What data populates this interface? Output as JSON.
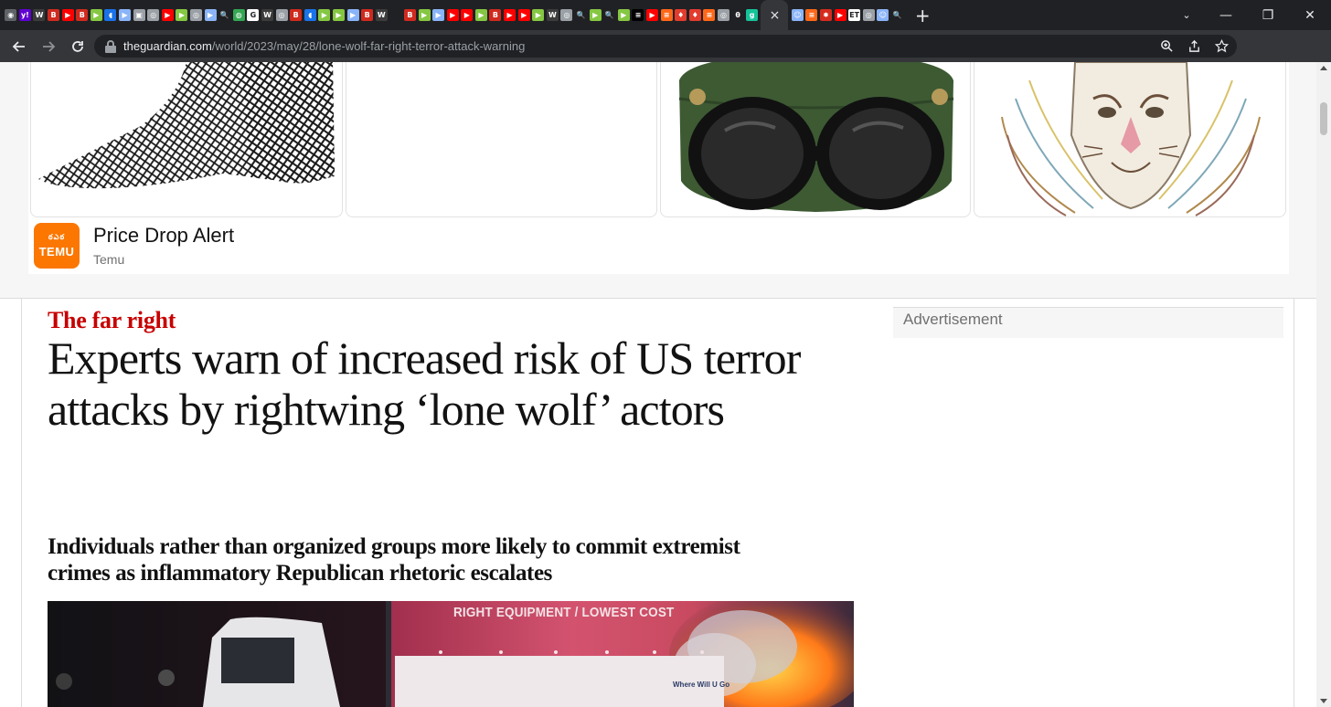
{
  "browser": {
    "url_host": "theguardian.com",
    "url_path": "/world/2023/may/28/lone-wolf-far-right-terror-attack-warning",
    "tab_favicons": [
      {
        "icon": "chrome-icon",
        "color": "#5f6368",
        "glyph": "◉"
      },
      {
        "icon": "yahoo-icon",
        "color": "#6001d2",
        "glyph": "y!"
      },
      {
        "icon": "wsj-icon",
        "color": "#3c3c3c",
        "glyph": "W"
      },
      {
        "icon": "business-insider-icon",
        "color": "#d02a1e",
        "glyph": "B"
      },
      {
        "icon": "youtube-icon",
        "color": "#ff0000",
        "glyph": "▶"
      },
      {
        "icon": "business-insider-icon",
        "color": "#d02a1e",
        "glyph": "B"
      },
      {
        "icon": "rumble-icon",
        "color": "#85c742",
        "glyph": "▶"
      },
      {
        "icon": "shield-icon",
        "color": "#1a73e8",
        "glyph": "◖"
      },
      {
        "icon": "bookmark-icon",
        "color": "#8ab4f8",
        "glyph": "▶"
      },
      {
        "icon": "image-icon",
        "color": "#9aa0a6",
        "glyph": "▣"
      },
      {
        "icon": "globe-icon",
        "color": "#9aa0a6",
        "glyph": "◎"
      },
      {
        "icon": "youtube-icon",
        "color": "#ff0000",
        "glyph": "▶"
      },
      {
        "icon": "rumble-icon",
        "color": "#85c742",
        "glyph": "▶"
      },
      {
        "icon": "globe-icon",
        "color": "#9aa0a6",
        "glyph": "◎"
      },
      {
        "icon": "bookmark-icon",
        "color": "#8ab4f8",
        "glyph": "▶"
      },
      {
        "icon": "search-icon",
        "color": "#202124",
        "glyph": "🔍"
      },
      {
        "icon": "map-icon",
        "color": "#34a853",
        "glyph": "◍"
      },
      {
        "icon": "google-icon",
        "color": "#ffffff",
        "glyph": "G"
      },
      {
        "icon": "wsj-icon",
        "color": "#3c3c3c",
        "glyph": "W"
      },
      {
        "icon": "globe-icon",
        "color": "#9aa0a6",
        "glyph": "◎"
      },
      {
        "icon": "business-insider-icon",
        "color": "#d02a1e",
        "glyph": "B"
      },
      {
        "icon": "shield-icon",
        "color": "#1a73e8",
        "glyph": "◖"
      },
      {
        "icon": "rumble-icon",
        "color": "#85c742",
        "glyph": "▶"
      },
      {
        "icon": "rumble-icon",
        "color": "#85c742",
        "glyph": "▶"
      },
      {
        "icon": "bookmark-icon",
        "color": "#8ab4f8",
        "glyph": "▶"
      },
      {
        "icon": "business-insider-icon",
        "color": "#d02a1e",
        "glyph": "B"
      },
      {
        "icon": "wsj-icon",
        "color": "#3c3c3c",
        "glyph": "W"
      },
      {
        "icon": "blank-icon",
        "color": "#202124",
        "glyph": " "
      },
      {
        "icon": "business-insider-icon",
        "color": "#d02a1e",
        "glyph": "B"
      },
      {
        "icon": "rumble-icon",
        "color": "#85c742",
        "glyph": "▶"
      },
      {
        "icon": "bookmark-icon",
        "color": "#8ab4f8",
        "glyph": "▶"
      },
      {
        "icon": "youtube-icon",
        "color": "#ff0000",
        "glyph": "▶"
      },
      {
        "icon": "youtube-icon",
        "color": "#ff0000",
        "glyph": "▶"
      },
      {
        "icon": "rumble-icon",
        "color": "#85c742",
        "glyph": "▶"
      },
      {
        "icon": "business-insider-icon",
        "color": "#d02a1e",
        "glyph": "B"
      },
      {
        "icon": "youtube-icon",
        "color": "#ff0000",
        "glyph": "▶"
      },
      {
        "icon": "youtube-icon",
        "color": "#ff0000",
        "glyph": "▶"
      },
      {
        "icon": "rumble-icon",
        "color": "#85c742",
        "glyph": "▶"
      },
      {
        "icon": "wsj-icon",
        "color": "#3c3c3c",
        "glyph": "W"
      },
      {
        "icon": "globe-icon",
        "color": "#9aa0a6",
        "glyph": "◎"
      },
      {
        "icon": "search-icon",
        "color": "#202124",
        "glyph": "🔍"
      },
      {
        "icon": "rumble-icon",
        "color": "#85c742",
        "glyph": "▶"
      },
      {
        "icon": "search-icon",
        "color": "#202124",
        "glyph": "🔍"
      },
      {
        "icon": "rumble-icon",
        "color": "#85c742",
        "glyph": "▶"
      },
      {
        "icon": "abc-icon",
        "color": "#000000",
        "glyph": "≡"
      },
      {
        "icon": "youtube-icon",
        "color": "#ff0000",
        "glyph": "▶"
      },
      {
        "icon": "substack-icon",
        "color": "#ff6719",
        "glyph": "≡"
      },
      {
        "icon": "pin-icon",
        "color": "#e23c2e",
        "glyph": "♦"
      },
      {
        "icon": "pin-icon",
        "color": "#e23c2e",
        "glyph": "♦"
      },
      {
        "icon": "substack-icon",
        "color": "#ff6719",
        "glyph": "≡"
      },
      {
        "icon": "globe-icon",
        "color": "#9aa0a6",
        "glyph": "◎"
      },
      {
        "icon": "theta-icon",
        "color": "#202124",
        "glyph": "θ"
      },
      {
        "icon": "grammarly-icon",
        "color": "#15c39a",
        "glyph": "g"
      }
    ],
    "active_tab_close": "×",
    "tab_favicons_after": [
      {
        "icon": "portrait-icon",
        "color": "#8ab4f8",
        "glyph": "☺"
      },
      {
        "icon": "substack-icon",
        "color": "#ff6719",
        "glyph": "≡"
      },
      {
        "icon": "maple-leaf-icon",
        "color": "#d52b1e",
        "glyph": "✸"
      },
      {
        "icon": "youtube-icon",
        "color": "#ff0000",
        "glyph": "▶"
      },
      {
        "icon": "epoch-times-icon",
        "color": "#ffffff",
        "glyph": "ET"
      },
      {
        "icon": "globe-icon",
        "color": "#9aa0a6",
        "glyph": "◎"
      },
      {
        "icon": "portrait-icon",
        "color": "#8ab4f8",
        "glyph": "☺"
      },
      {
        "icon": "search-icon",
        "color": "#202124",
        "glyph": "🔍"
      }
    ],
    "new_tab": "+",
    "window_controls": {
      "tab_search": "⌄",
      "minimize": "—",
      "restore": "❐",
      "close": "✕"
    }
  },
  "ad": {
    "title": "Price Drop Alert",
    "brand": "Temu",
    "logo_text": "TEMU",
    "logo_mini": "ఠఎఠ"
  },
  "article": {
    "kicker": "The far right",
    "headline": "Experts warn of increased risk of US terror attacks by rightwing ‘lone wolf’ actors",
    "standfirst": "Individuals rather than organized groups more likely to commit extremist crimes as inflammatory Republican rhetoric escalates",
    "advert_label": "Advertisement",
    "hero_sign_text": "RIGHT EQUIPMENT / LOWEST COST",
    "hero_truck_text": "Where Will U Go"
  }
}
